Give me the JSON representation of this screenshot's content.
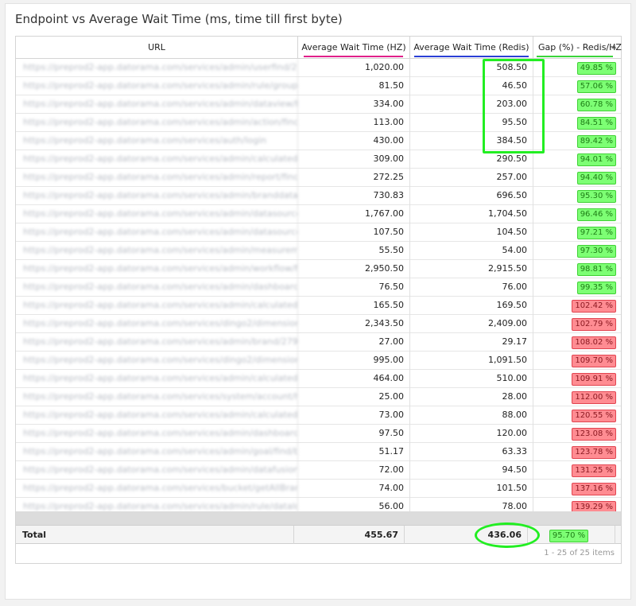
{
  "title": "Endpoint vs Average Wait Time (ms, time till first byte)",
  "columns": {
    "url": "URL",
    "hz": "Average Wait Time (HZ)",
    "redis": "Average Wait Time (Redis)",
    "gap": "Gap (%) - Redis/HZ"
  },
  "colors": {
    "hz_underline": "#e0208a",
    "redis_underline": "#2a3fd6",
    "gap_underline": "#3ad43a",
    "highlight": "#22ee22"
  },
  "rows": [
    {
      "url": "https://preprod2-app.datorama.com/services/admin/userfind/235...",
      "hz": "1,020.00",
      "redis": "508.50",
      "gap": "49.85 %",
      "status": "good"
    },
    {
      "url": "https://preprod2-app.datorama.com/services/admin/rule/group/fi...",
      "hz": "81.50",
      "redis": "46.50",
      "gap": "57.06 %",
      "status": "good"
    },
    {
      "url": "https://preprod2-app.datorama.com/services/admin/dataview/find...",
      "hz": "334.00",
      "redis": "203.00",
      "gap": "60.78 %",
      "status": "good"
    },
    {
      "url": "https://preprod2-app.datorama.com/services/admin/action/findb...",
      "hz": "113.00",
      "redis": "95.50",
      "gap": "84.51 %",
      "status": "good"
    },
    {
      "url": "https://preprod2-app.datorama.com/services/auth/login",
      "hz": "430.00",
      "redis": "384.50",
      "gap": "89.42 %",
      "status": "good"
    },
    {
      "url": "https://preprod2-app.datorama.com/services/admin/calculatedm...",
      "hz": "309.00",
      "redis": "290.50",
      "gap": "94.01 %",
      "status": "good"
    },
    {
      "url": "https://preprod2-app.datorama.com/services/admin/report/findb...",
      "hz": "272.25",
      "redis": "257.00",
      "gap": "94.40 %",
      "status": "good"
    },
    {
      "url": "https://preprod2-app.datorama.com/services/admin/branddatas...",
      "hz": "730.83",
      "redis": "696.50",
      "gap": "95.30 %",
      "status": "good"
    },
    {
      "url": "https://preprod2-app.datorama.com/services/admin/datasource/m...",
      "hz": "1,767.00",
      "redis": "1,704.50",
      "gap": "96.46 %",
      "status": "good"
    },
    {
      "url": "https://preprod2-app.datorama.com/services/admin/datasource/da...",
      "hz": "107.50",
      "redis": "104.50",
      "gap": "97.21 %",
      "status": "good"
    },
    {
      "url": "https://preprod2-app.datorama.com/services/admin/measuremen...",
      "hz": "55.50",
      "redis": "54.00",
      "gap": "97.30 %",
      "status": "good"
    },
    {
      "url": "https://preprod2-app.datorama.com/services/admin/workflow/find...",
      "hz": "2,950.50",
      "redis": "2,915.50",
      "gap": "98.81 %",
      "status": "good"
    },
    {
      "url": "https://preprod2-app.datorama.com/services/admin/dashboard/fi...",
      "hz": "76.50",
      "redis": "76.00",
      "gap": "99.35 %",
      "status": "good"
    },
    {
      "url": "https://preprod2-app.datorama.com/services/admin/calculatedme...",
      "hz": "165.50",
      "redis": "169.50",
      "gap": "102.42 %",
      "status": "bad"
    },
    {
      "url": "https://preprod2-app.datorama.com/services/dingo2/dimension/fi...",
      "hz": "2,343.50",
      "redis": "2,409.00",
      "gap": "102.79 %",
      "status": "bad"
    },
    {
      "url": "https://preprod2-app.datorama.com/services/admin/brand/2797/...",
      "hz": "27.00",
      "redis": "29.17",
      "gap": "108.02 %",
      "status": "bad"
    },
    {
      "url": "https://preprod2-app.datorama.com/services/dingo2/dimension/C...",
      "hz": "995.00",
      "redis": "1,091.50",
      "gap": "109.70 %",
      "status": "bad"
    },
    {
      "url": "https://preprod2-app.datorama.com/services/admin/calculatedme...",
      "hz": "464.00",
      "redis": "510.00",
      "gap": "109.91 %",
      "status": "bad"
    },
    {
      "url": "https://preprod2-app.datorama.com/services/system/account/has...",
      "hz": "25.00",
      "redis": "28.00",
      "gap": "112.00 %",
      "status": "bad"
    },
    {
      "url": "https://preprod2-app.datorama.com/services/admin/calculatedm...",
      "hz": "73.00",
      "redis": "88.00",
      "gap": "120.55 %",
      "status": "bad"
    },
    {
      "url": "https://preprod2-app.datorama.com/services/admin/dashboard/p...",
      "hz": "97.50",
      "redis": "120.00",
      "gap": "123.08 %",
      "status": "bad"
    },
    {
      "url": "https://preprod2-app.datorama.com/services/admin/goal/find/bra...",
      "hz": "51.17",
      "redis": "63.33",
      "gap": "123.78 %",
      "status": "bad"
    },
    {
      "url": "https://preprod2-app.datorama.com/services/admin/datafusion/fi...",
      "hz": "72.00",
      "redis": "94.50",
      "gap": "131.25 %",
      "status": "bad"
    },
    {
      "url": "https://preprod2-app.datorama.com/services/bucket/getAllBrand...",
      "hz": "74.00",
      "redis": "101.50",
      "gap": "137.16 %",
      "status": "bad"
    },
    {
      "url": "https://preprod2-app.datorama.com/services/admin/rule/dataload...",
      "hz": "56.00",
      "redis": "78.00",
      "gap": "139.29 %",
      "status": "bad"
    }
  ],
  "total": {
    "label": "Total",
    "hz": "455.67",
    "redis": "436.06",
    "gap": "95.70 %",
    "status": "good"
  },
  "pager": "1 - 25 of 25 items",
  "sort_icon": "sort-arrow-icon"
}
